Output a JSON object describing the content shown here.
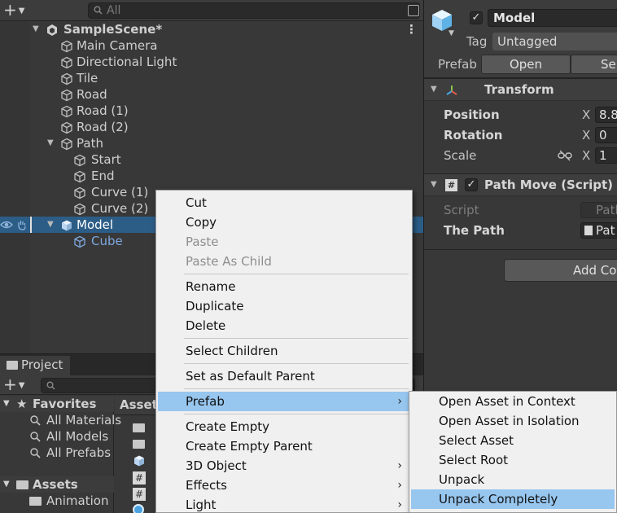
{
  "hierarchy": {
    "search_placeholder": "All",
    "scene_name": "SampleScene*",
    "items": [
      {
        "label": "Main Camera"
      },
      {
        "label": "Directional Light"
      },
      {
        "label": "Tile"
      },
      {
        "label": "Road"
      },
      {
        "label": "Road (1)"
      },
      {
        "label": "Road (2)"
      },
      {
        "label": "Path"
      },
      {
        "label": "Start"
      },
      {
        "label": "End"
      },
      {
        "label": "Curve (1)"
      },
      {
        "label": "Curve (2)"
      },
      {
        "label": "Model"
      },
      {
        "label": "Cube"
      }
    ]
  },
  "project": {
    "tab_label": "Project",
    "favorites_label": "Favorites",
    "favorites": [
      "All Materials",
      "All Models",
      "All Prefabs"
    ],
    "assets_label": "Assets",
    "asset_folders": [
      "Animation"
    ],
    "breadcrumb": "Assets"
  },
  "inspector": {
    "object_name": "Model",
    "tag_label": "Tag",
    "tag_value": "Untagged",
    "prefab_label": "Prefab",
    "open_button": "Open",
    "select_button": "Se",
    "transform": {
      "title": "Transform",
      "position_label": "Position",
      "rotation_label": "Rotation",
      "scale_label": "Scale",
      "axis_x": "X",
      "position_x": "8.8",
      "rotation_x": "0",
      "scale_x": "1"
    },
    "path_move": {
      "title": "Path Move (Script)",
      "script_label": "Script",
      "script_value": "Path",
      "the_path_label": "The Path",
      "the_path_value": "Pat"
    },
    "add_component": "Add Co"
  },
  "context_menu": {
    "items": [
      {
        "label": "Cut",
        "enabled": true
      },
      {
        "label": "Copy",
        "enabled": true
      },
      {
        "label": "Paste",
        "enabled": false
      },
      {
        "label": "Paste As Child",
        "enabled": false
      },
      {
        "label": "Rename",
        "enabled": true
      },
      {
        "label": "Duplicate",
        "enabled": true
      },
      {
        "label": "Delete",
        "enabled": true
      },
      {
        "label": "Select Children",
        "enabled": true
      },
      {
        "label": "Set as Default Parent",
        "enabled": true
      },
      {
        "label": "Prefab",
        "enabled": true,
        "submenu": true,
        "highlighted": true
      },
      {
        "label": "Create Empty",
        "enabled": true
      },
      {
        "label": "Create Empty Parent",
        "enabled": true
      },
      {
        "label": "3D Object",
        "enabled": true,
        "submenu": true
      },
      {
        "label": "Effects",
        "enabled": true,
        "submenu": true
      },
      {
        "label": "Light",
        "enabled": true,
        "submenu": true
      }
    ]
  },
  "prefab_submenu": {
    "items": [
      {
        "label": "Open Asset in Context"
      },
      {
        "label": "Open Asset in Isolation"
      },
      {
        "label": "Select Asset"
      },
      {
        "label": "Select Root"
      },
      {
        "label": "Unpack"
      },
      {
        "label": "Unpack Completely",
        "highlighted": true
      }
    ]
  },
  "colors": {
    "selection": "#2c5d87",
    "menu_highlight": "#97c6ef",
    "panel": "#383838"
  }
}
